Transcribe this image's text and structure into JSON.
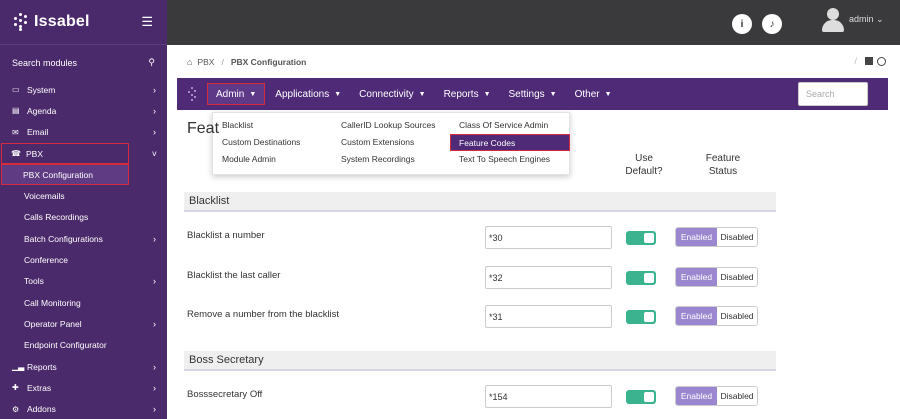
{
  "brand": {
    "name": "Issabel",
    "menu_icon": "hamburger-icon"
  },
  "sidebar": {
    "search_label": "Search modules",
    "items": [
      {
        "label": "System",
        "icon": "laptop-icon",
        "has_children": true
      },
      {
        "label": "Agenda",
        "icon": "book-icon",
        "has_children": true
      },
      {
        "label": "Email",
        "icon": "envelope-icon",
        "has_children": true
      },
      {
        "label": "PBX",
        "icon": "phone-icon",
        "expanded": true
      },
      {
        "label": "PBX Configuration",
        "sub": true,
        "active": true
      },
      {
        "label": "Voicemails",
        "sub": true
      },
      {
        "label": "Calls Recordings",
        "sub": true
      },
      {
        "label": "Batch Configurations",
        "sub": true,
        "has_children": true
      },
      {
        "label": "Conference",
        "sub": true
      },
      {
        "label": "Tools",
        "sub": true,
        "has_children": true
      },
      {
        "label": "Call Monitoring",
        "sub": true
      },
      {
        "label": "Operator Panel",
        "sub": true,
        "has_children": true
      },
      {
        "label": "Endpoint Configurator",
        "sub": true
      },
      {
        "label": "Reports",
        "icon": "bar-chart-icon",
        "has_children": true
      },
      {
        "label": "Extras",
        "icon": "plus-icon",
        "has_children": true
      },
      {
        "label": "Addons",
        "icon": "gear-icon",
        "has_children": true
      }
    ]
  },
  "topbar": {
    "user": "admin",
    "info_icon": "info-icon",
    "bell_icon": "bell-icon"
  },
  "breadcrumb": {
    "home": "PBX",
    "current": "PBX Configuration"
  },
  "navbar": {
    "items": [
      "Admin",
      "Applications",
      "Connectivity",
      "Reports",
      "Settings",
      "Other"
    ],
    "active": "Admin",
    "search_placeholder": "Search"
  },
  "dropdown": {
    "col1": [
      "Blacklist",
      "Custom Destinations",
      "Module Admin"
    ],
    "col2": [
      "CallerID Lookup Sources",
      "Custom Extensions",
      "System Recordings"
    ],
    "col3": [
      "Class Of Service Admin",
      "Feature Codes",
      "Text To Speech Engines"
    ],
    "highlighted": "Feature Codes"
  },
  "main": {
    "title_fragment": "Feat",
    "col_use_default": [
      "Use",
      "Default?"
    ],
    "col_feature_status": [
      "Feature",
      "Status"
    ],
    "enabled_label": "Enabled",
    "disabled_label": "Disabled",
    "sections": [
      {
        "title": "Blacklist",
        "rows": [
          {
            "label": "Blacklist a number",
            "code": "*30",
            "use_default": true,
            "status": "Enabled"
          },
          {
            "label": "Blacklist the last caller",
            "code": "*32",
            "use_default": true,
            "status": "Enabled"
          },
          {
            "label": "Remove a number from the blacklist",
            "code": "*31",
            "use_default": true,
            "status": "Enabled"
          }
        ]
      },
      {
        "title": "Boss Secretary",
        "rows": [
          {
            "label": "Bosssecretary Off",
            "code": "*154",
            "use_default": true,
            "status": "Enabled"
          }
        ]
      }
    ]
  },
  "colors": {
    "sidebar": "#4b2a6b",
    "navbar": "#4e2a77",
    "highlight_border": "#d62b3c",
    "toggle_on": "#3bb38e",
    "enabled": "#9b87cf"
  }
}
